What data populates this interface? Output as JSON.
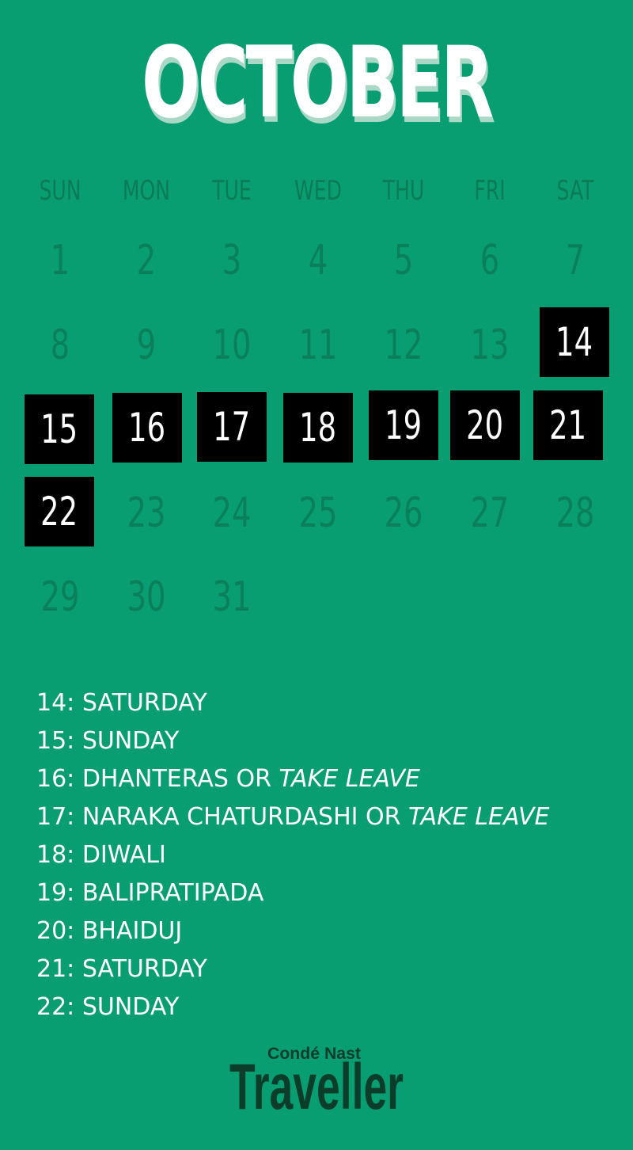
{
  "title": "OCTOBER",
  "weekdays": [
    "SUN",
    "MON",
    "TUE",
    "WED",
    "THU",
    "FRI",
    "SAT"
  ],
  "days": [
    "1",
    "2",
    "3",
    "4",
    "5",
    "6",
    "7",
    "8",
    "9",
    "10",
    "11",
    "12",
    "13",
    "14",
    "15",
    "16",
    "17",
    "18",
    "19",
    "20",
    "21",
    "22",
    "23",
    "24",
    "25",
    "26",
    "27",
    "28",
    "29",
    "30",
    "31"
  ],
  "highlighted_days": [
    "14",
    "15",
    "16",
    "17",
    "18",
    "19",
    "20",
    "21",
    "22"
  ],
  "notes": [
    {
      "prefix": "14: SATURDAY",
      "alt": ""
    },
    {
      "prefix": "15: SUNDAY",
      "alt": ""
    },
    {
      "prefix": "16: DHANTERAS OR ",
      "alt": "TAKE LEAVE"
    },
    {
      "prefix": "17: NARAKA CHATURDASHI OR ",
      "alt": "TAKE LEAVE"
    },
    {
      "prefix": "18: DIWALI",
      "alt": ""
    },
    {
      "prefix": "19: BALIPRATIPADA",
      "alt": ""
    },
    {
      "prefix": "20: BHAIDUJ",
      "alt": ""
    },
    {
      "prefix": "21: SATURDAY",
      "alt": ""
    },
    {
      "prefix": "22: SUNDAY",
      "alt": ""
    }
  ],
  "logo": {
    "line1": "Condé Nast",
    "line2": "Traveller"
  },
  "colors": {
    "background": "#089e72",
    "muted_text": "#0b7a55",
    "highlight_bg": "#000000",
    "highlight_text": "#ffffff",
    "logo": "#0b3d2a"
  }
}
